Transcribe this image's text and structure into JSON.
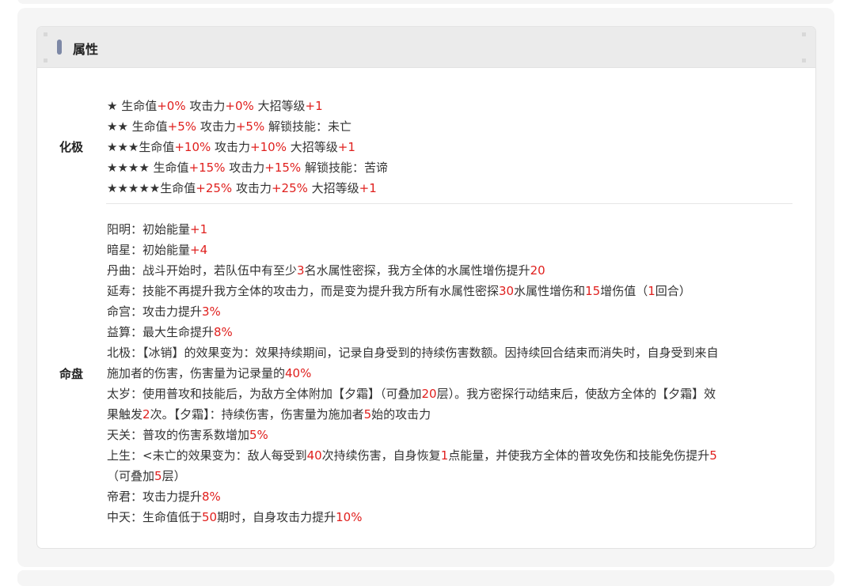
{
  "header": {
    "title": "属性"
  },
  "sections": [
    {
      "label": "化极",
      "lines": [
        [
          {
            "t": "★ 生命值"
          },
          {
            "t": "+0%",
            "r": 1
          },
          {
            "t": " 攻击力"
          },
          {
            "t": "+0%",
            "r": 1
          },
          {
            "t": " 大招等级"
          },
          {
            "t": "+1",
            "r": 1
          }
        ],
        [
          {
            "t": "★★ 生命值"
          },
          {
            "t": "+5%",
            "r": 1
          },
          {
            "t": " 攻击力"
          },
          {
            "t": "+5%",
            "r": 1
          },
          {
            "t": " 解锁技能：未亡"
          }
        ],
        [
          {
            "t": "★★★生命值"
          },
          {
            "t": "+10%",
            "r": 1
          },
          {
            "t": " 攻击力"
          },
          {
            "t": "+10%",
            "r": 1
          },
          {
            "t": " 大招等级"
          },
          {
            "t": "+1",
            "r": 1
          }
        ],
        [
          {
            "t": "★★★★ 生命值"
          },
          {
            "t": "+15%",
            "r": 1
          },
          {
            "t": " 攻击力"
          },
          {
            "t": "+15%",
            "r": 1
          },
          {
            "t": " 解锁技能：苦谛"
          }
        ],
        [
          {
            "t": "★★★★★生命值"
          },
          {
            "t": "+25%",
            "r": 1
          },
          {
            "t": " 攻击力"
          },
          {
            "t": "+25%",
            "r": 1
          },
          {
            "t": " 大招等级"
          },
          {
            "t": "+1",
            "r": 1
          }
        ]
      ]
    },
    {
      "label": "命盘",
      "lines": [
        [
          {
            "t": "阳明：初始能量"
          },
          {
            "t": "+1",
            "r": 1
          }
        ],
        [
          {
            "t": "暗星：初始能量"
          },
          {
            "t": "+4",
            "r": 1
          }
        ],
        [
          {
            "t": "丹曲：战斗开始时，若队伍中有至少"
          },
          {
            "t": "3",
            "r": 1
          },
          {
            "t": "名水属性密探，我方全体的水属性增伤提升"
          },
          {
            "t": "20",
            "r": 1
          }
        ],
        [
          {
            "t": "延寿：技能不再提升我方全体的攻击力，而是变为提升我方所有水属性密探"
          },
          {
            "t": "30",
            "r": 1
          },
          {
            "t": "水属性增伤和"
          },
          {
            "t": "15",
            "r": 1
          },
          {
            "t": "增伤值（"
          },
          {
            "t": "1",
            "r": 1
          },
          {
            "t": "回合）"
          }
        ],
        [
          {
            "t": "命宫：攻击力提升"
          },
          {
            "t": "3%",
            "r": 1
          }
        ],
        [
          {
            "t": "益算：最大生命提升"
          },
          {
            "t": "8%",
            "r": 1
          }
        ],
        [
          {
            "t": "北极：【冰销】的效果变为：效果持续期间，记录自身受到的持续伤害数额。因持续回合结束而消失时，自身受到来自"
          }
        ],
        [
          {
            "t": "施加者的伤害，伤害量为记录量的"
          },
          {
            "t": "40%",
            "r": 1
          }
        ],
        [
          {
            "t": "太岁：使用普攻和技能后，为敌方全体附加【夕霜】（可叠加"
          },
          {
            "t": "20",
            "r": 1
          },
          {
            "t": "层）。我方密探行动结束后，使敌方全体的【夕霜】效"
          }
        ],
        [
          {
            "t": "果触发"
          },
          {
            "t": "2",
            "r": 1
          },
          {
            "t": "次。【夕霜】：持续伤害，伤害量为施加者"
          },
          {
            "t": "5",
            "r": 1
          },
          {
            "t": "始的攻击力"
          }
        ],
        [
          {
            "t": "天关：普攻的伤害系数增加"
          },
          {
            "t": "5%",
            "r": 1
          }
        ],
        [
          {
            "t": "上生：<未亡的效果变为：敌人每受到"
          },
          {
            "t": "40",
            "r": 1
          },
          {
            "t": "次持续伤害，自身恢复"
          },
          {
            "t": "1",
            "r": 1
          },
          {
            "t": "点能量，并使我方全体的普攻免伤和技能免伤提升"
          },
          {
            "t": "5",
            "r": 1
          }
        ],
        [
          {
            "t": "（可叠加"
          },
          {
            "t": "5",
            "r": 1
          },
          {
            "t": "层）"
          }
        ],
        [
          {
            "t": "帝君：攻击力提升"
          },
          {
            "t": "8%",
            "r": 1
          }
        ],
        [
          {
            "t": "中天：生命值低于"
          },
          {
            "t": "50",
            "r": 1
          },
          {
            "t": "期时，自身攻击力提升"
          },
          {
            "t": "10%",
            "r": 1
          }
        ]
      ]
    }
  ],
  "colors": {
    "accent": "#e0201e",
    "bar": "#7d88a6"
  }
}
